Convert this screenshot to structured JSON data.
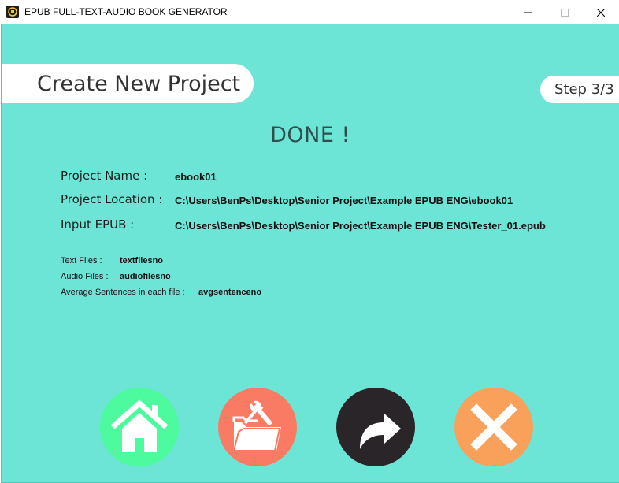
{
  "window": {
    "title": "EPUB FULL-TEXT-AUDIO BOOK GENERATOR",
    "minimize_glyph": "—",
    "maximize_glyph": "☐",
    "close_glyph": "✕"
  },
  "header": {
    "title": "Create New Project",
    "step": "Step 3/3"
  },
  "status": "DONE !",
  "project": {
    "name_label": "Project Name :",
    "name_value": "ebook01",
    "location_label": "Project Location :",
    "location_value": "C:\\Users\\BenPs\\Desktop\\Senior Project\\Example EPUB ENG\\ebook01",
    "input_label": "Input EPUB :",
    "input_value": "C:\\Users\\BenPs\\Desktop\\Senior Project\\Example EPUB ENG\\Tester_01.epub"
  },
  "stats": {
    "text_files_label": "Text Files :",
    "text_files_value": "textfilesno",
    "audio_files_label": "Audio Files :",
    "audio_files_value": "audiofilesno",
    "avg_label": "Average Sentences in each file :",
    "avg_value": "avgsentenceno"
  },
  "buttons": [
    {
      "name": "home",
      "icon": "home-icon",
      "color": "#4dfa9e"
    },
    {
      "name": "open-folder",
      "icon": "folder-tools-icon",
      "color": "#f97b64"
    },
    {
      "name": "forward",
      "icon": "forward-arrow-icon",
      "color": "#2a2529"
    },
    {
      "name": "close",
      "icon": "close-x-icon",
      "color": "#f9a05a"
    }
  ],
  "colors": {
    "background": "#6ce5d6",
    "pill": "#ffffff"
  }
}
